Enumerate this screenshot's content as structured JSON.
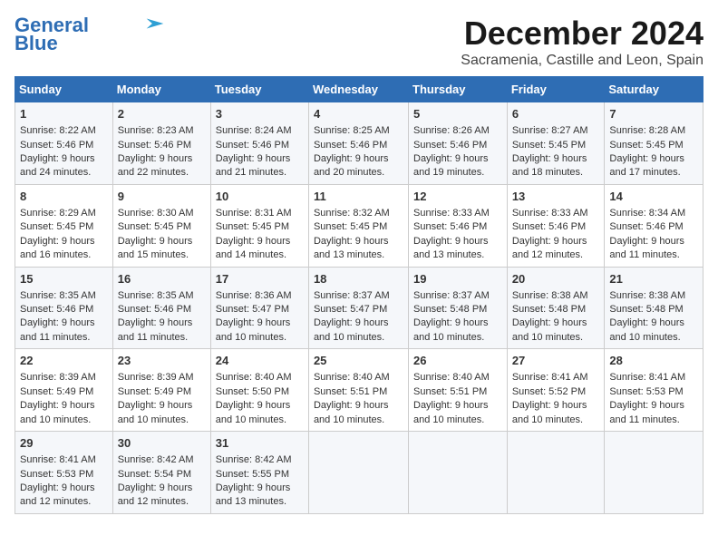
{
  "logo": {
    "line1": "General",
    "line2": "Blue"
  },
  "title": "December 2024",
  "subtitle": "Sacramenia, Castille and Leon, Spain",
  "weekdays": [
    "Sunday",
    "Monday",
    "Tuesday",
    "Wednesday",
    "Thursday",
    "Friday",
    "Saturday"
  ],
  "weeks": [
    [
      {
        "day": 1,
        "rise": "Sunrise: 8:22 AM",
        "set": "Sunset: 5:46 PM",
        "daylight": "Daylight: 9 hours and 24 minutes."
      },
      {
        "day": 2,
        "rise": "Sunrise: 8:23 AM",
        "set": "Sunset: 5:46 PM",
        "daylight": "Daylight: 9 hours and 22 minutes."
      },
      {
        "day": 3,
        "rise": "Sunrise: 8:24 AM",
        "set": "Sunset: 5:46 PM",
        "daylight": "Daylight: 9 hours and 21 minutes."
      },
      {
        "day": 4,
        "rise": "Sunrise: 8:25 AM",
        "set": "Sunset: 5:46 PM",
        "daylight": "Daylight: 9 hours and 20 minutes."
      },
      {
        "day": 5,
        "rise": "Sunrise: 8:26 AM",
        "set": "Sunset: 5:46 PM",
        "daylight": "Daylight: 9 hours and 19 minutes."
      },
      {
        "day": 6,
        "rise": "Sunrise: 8:27 AM",
        "set": "Sunset: 5:45 PM",
        "daylight": "Daylight: 9 hours and 18 minutes."
      },
      {
        "day": 7,
        "rise": "Sunrise: 8:28 AM",
        "set": "Sunset: 5:45 PM",
        "daylight": "Daylight: 9 hours and 17 minutes."
      }
    ],
    [
      {
        "day": 8,
        "rise": "Sunrise: 8:29 AM",
        "set": "Sunset: 5:45 PM",
        "daylight": "Daylight: 9 hours and 16 minutes."
      },
      {
        "day": 9,
        "rise": "Sunrise: 8:30 AM",
        "set": "Sunset: 5:45 PM",
        "daylight": "Daylight: 9 hours and 15 minutes."
      },
      {
        "day": 10,
        "rise": "Sunrise: 8:31 AM",
        "set": "Sunset: 5:45 PM",
        "daylight": "Daylight: 9 hours and 14 minutes."
      },
      {
        "day": 11,
        "rise": "Sunrise: 8:32 AM",
        "set": "Sunset: 5:45 PM",
        "daylight": "Daylight: 9 hours and 13 minutes."
      },
      {
        "day": 12,
        "rise": "Sunrise: 8:33 AM",
        "set": "Sunset: 5:46 PM",
        "daylight": "Daylight: 9 hours and 13 minutes."
      },
      {
        "day": 13,
        "rise": "Sunrise: 8:33 AM",
        "set": "Sunset: 5:46 PM",
        "daylight": "Daylight: 9 hours and 12 minutes."
      },
      {
        "day": 14,
        "rise": "Sunrise: 8:34 AM",
        "set": "Sunset: 5:46 PM",
        "daylight": "Daylight: 9 hours and 11 minutes."
      }
    ],
    [
      {
        "day": 15,
        "rise": "Sunrise: 8:35 AM",
        "set": "Sunset: 5:46 PM",
        "daylight": "Daylight: 9 hours and 11 minutes."
      },
      {
        "day": 16,
        "rise": "Sunrise: 8:35 AM",
        "set": "Sunset: 5:46 PM",
        "daylight": "Daylight: 9 hours and 11 minutes."
      },
      {
        "day": 17,
        "rise": "Sunrise: 8:36 AM",
        "set": "Sunset: 5:47 PM",
        "daylight": "Daylight: 9 hours and 10 minutes."
      },
      {
        "day": 18,
        "rise": "Sunrise: 8:37 AM",
        "set": "Sunset: 5:47 PM",
        "daylight": "Daylight: 9 hours and 10 minutes."
      },
      {
        "day": 19,
        "rise": "Sunrise: 8:37 AM",
        "set": "Sunset: 5:48 PM",
        "daylight": "Daylight: 9 hours and 10 minutes."
      },
      {
        "day": 20,
        "rise": "Sunrise: 8:38 AM",
        "set": "Sunset: 5:48 PM",
        "daylight": "Daylight: 9 hours and 10 minutes."
      },
      {
        "day": 21,
        "rise": "Sunrise: 8:38 AM",
        "set": "Sunset: 5:48 PM",
        "daylight": "Daylight: 9 hours and 10 minutes."
      }
    ],
    [
      {
        "day": 22,
        "rise": "Sunrise: 8:39 AM",
        "set": "Sunset: 5:49 PM",
        "daylight": "Daylight: 9 hours and 10 minutes."
      },
      {
        "day": 23,
        "rise": "Sunrise: 8:39 AM",
        "set": "Sunset: 5:49 PM",
        "daylight": "Daylight: 9 hours and 10 minutes."
      },
      {
        "day": 24,
        "rise": "Sunrise: 8:40 AM",
        "set": "Sunset: 5:50 PM",
        "daylight": "Daylight: 9 hours and 10 minutes."
      },
      {
        "day": 25,
        "rise": "Sunrise: 8:40 AM",
        "set": "Sunset: 5:51 PM",
        "daylight": "Daylight: 9 hours and 10 minutes."
      },
      {
        "day": 26,
        "rise": "Sunrise: 8:40 AM",
        "set": "Sunset: 5:51 PM",
        "daylight": "Daylight: 9 hours and 10 minutes."
      },
      {
        "day": 27,
        "rise": "Sunrise: 8:41 AM",
        "set": "Sunset: 5:52 PM",
        "daylight": "Daylight: 9 hours and 10 minutes."
      },
      {
        "day": 28,
        "rise": "Sunrise: 8:41 AM",
        "set": "Sunset: 5:53 PM",
        "daylight": "Daylight: 9 hours and 11 minutes."
      }
    ],
    [
      {
        "day": 29,
        "rise": "Sunrise: 8:41 AM",
        "set": "Sunset: 5:53 PM",
        "daylight": "Daylight: 9 hours and 12 minutes."
      },
      {
        "day": 30,
        "rise": "Sunrise: 8:42 AM",
        "set": "Sunset: 5:54 PM",
        "daylight": "Daylight: 9 hours and 12 minutes."
      },
      {
        "day": 31,
        "rise": "Sunrise: 8:42 AM",
        "set": "Sunset: 5:55 PM",
        "daylight": "Daylight: 9 hours and 13 minutes."
      },
      null,
      null,
      null,
      null
    ]
  ]
}
